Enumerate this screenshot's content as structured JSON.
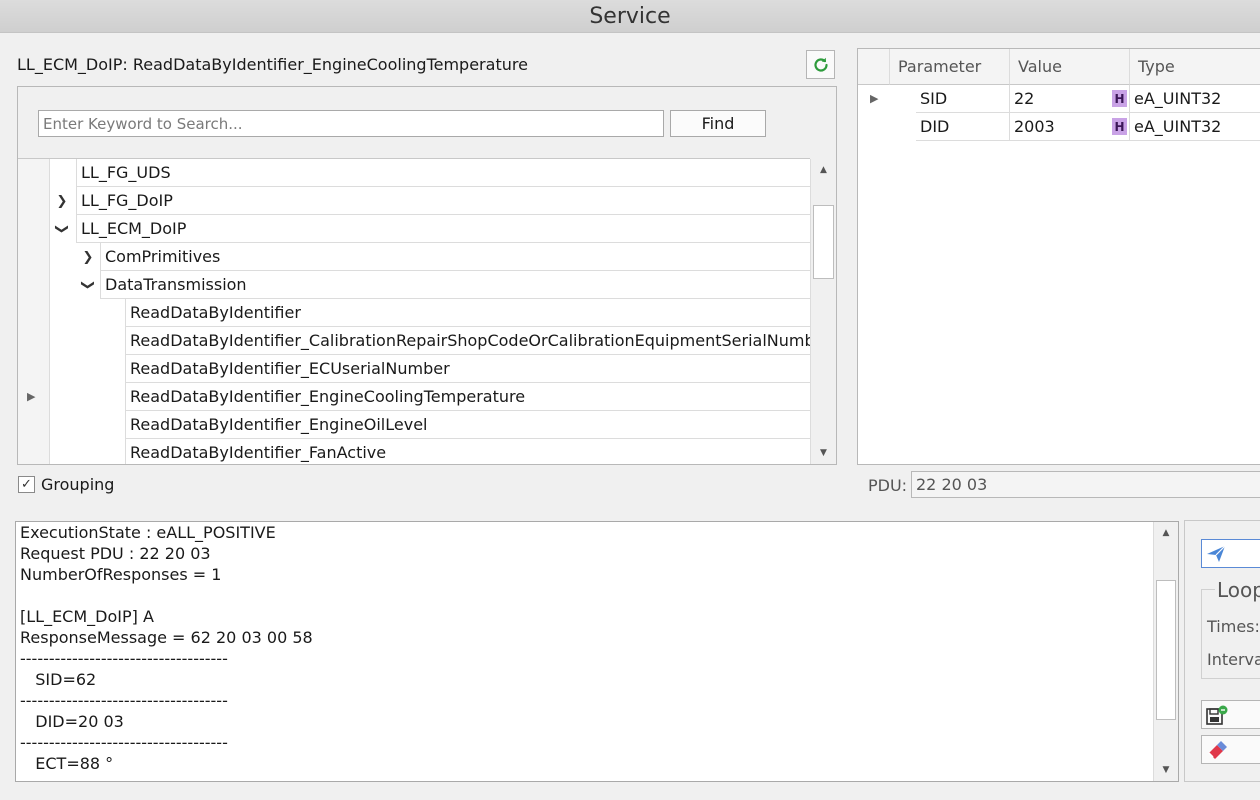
{
  "window": {
    "title": "Service"
  },
  "service": {
    "name": "LL_ECM_DoIP: ReadDataByIdentifier_EngineCoolingTemperature"
  },
  "search": {
    "placeholder": "Enter Keyword to Search...",
    "find_label": "Find"
  },
  "tree": {
    "items": [
      {
        "label": "LL_FG_UDS"
      },
      {
        "label": "LL_FG_DoIP"
      },
      {
        "label": "LL_ECM_DoIP"
      },
      {
        "label": "ComPrimitives"
      },
      {
        "label": "DataTransmission"
      },
      {
        "label": "ReadDataByIdentifier"
      },
      {
        "label": "ReadDataByIdentifier_CalibrationRepairShopCodeOrCalibrationEquipmentSerialNumber"
      },
      {
        "label": "ReadDataByIdentifier_ECUserialNumber"
      },
      {
        "label": "ReadDataByIdentifier_EngineCoolingTemperature"
      },
      {
        "label": "ReadDataByIdentifier_EngineOilLevel"
      },
      {
        "label": "ReadDataByIdentifier_FanActive"
      }
    ]
  },
  "grouping": {
    "label": "Grouping",
    "checked": true
  },
  "params": {
    "headers": {
      "parameter": "Parameter",
      "value": "Value",
      "type": "Type"
    },
    "rows": [
      {
        "parameter": "SID",
        "value": "22",
        "hex": "H",
        "type": "eA_UINT32"
      },
      {
        "parameter": "DID",
        "value": "2003",
        "hex": "H",
        "type": "eA_UINT32"
      }
    ]
  },
  "pdu": {
    "label": "PDU:",
    "value": "22 20 03"
  },
  "output": {
    "lines": [
      "ExecutionState : eALL_POSITIVE",
      "Request PDU : 22 20 03",
      "NumberOfResponses = 1",
      "",
      "[LL_ECM_DoIP] A",
      "ResponseMessage = 62 20 03 00 58",
      "------------------------------------",
      "   SID=62",
      "------------------------------------",
      "   DID=20 03",
      "------------------------------------",
      "   ECT=88 °"
    ]
  },
  "loop": {
    "title": "Loop",
    "times_label": "Times:",
    "interval_label": "Interva"
  }
}
